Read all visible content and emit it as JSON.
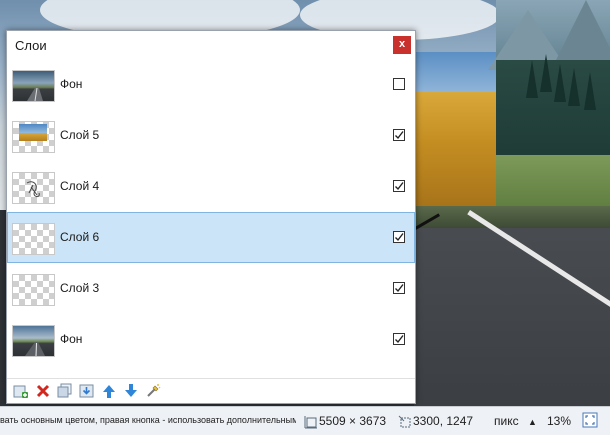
{
  "window": {
    "title": "Слои",
    "close_label": "x"
  },
  "layers": [
    {
      "name": "Фон",
      "visible": false,
      "selected": false,
      "thumb": "road"
    },
    {
      "name": "Слой 5",
      "visible": true,
      "selected": false,
      "thumb": "wheat"
    },
    {
      "name": "Слой 4",
      "visible": true,
      "selected": false,
      "thumb": "sketch"
    },
    {
      "name": "Слой 6",
      "visible": true,
      "selected": true,
      "thumb": "empty"
    },
    {
      "name": "Слой 3",
      "visible": true,
      "selected": false,
      "thumb": "empty"
    },
    {
      "name": "Фон",
      "visible": true,
      "selected": false,
      "thumb": "road2"
    }
  ],
  "toolbar": {
    "buttons": [
      "add-layer-icon",
      "delete-layer-icon",
      "duplicate-layer-icon",
      "merge-down-icon",
      "move-up-icon",
      "move-down-icon",
      "layer-properties-icon"
    ]
  },
  "status": {
    "hint": "вать основным цветом, правая кнопка - использовать дополнительным цветом.",
    "image_size": "5509 × 3673",
    "cursor_pos": "3300, 1247",
    "units": "пикс",
    "units_arrow": "▲",
    "zoom": "13%"
  },
  "colors": {
    "selected_row": "#cce4f7",
    "close_button": "#c9312c",
    "statusbar": "#eef1f5"
  }
}
